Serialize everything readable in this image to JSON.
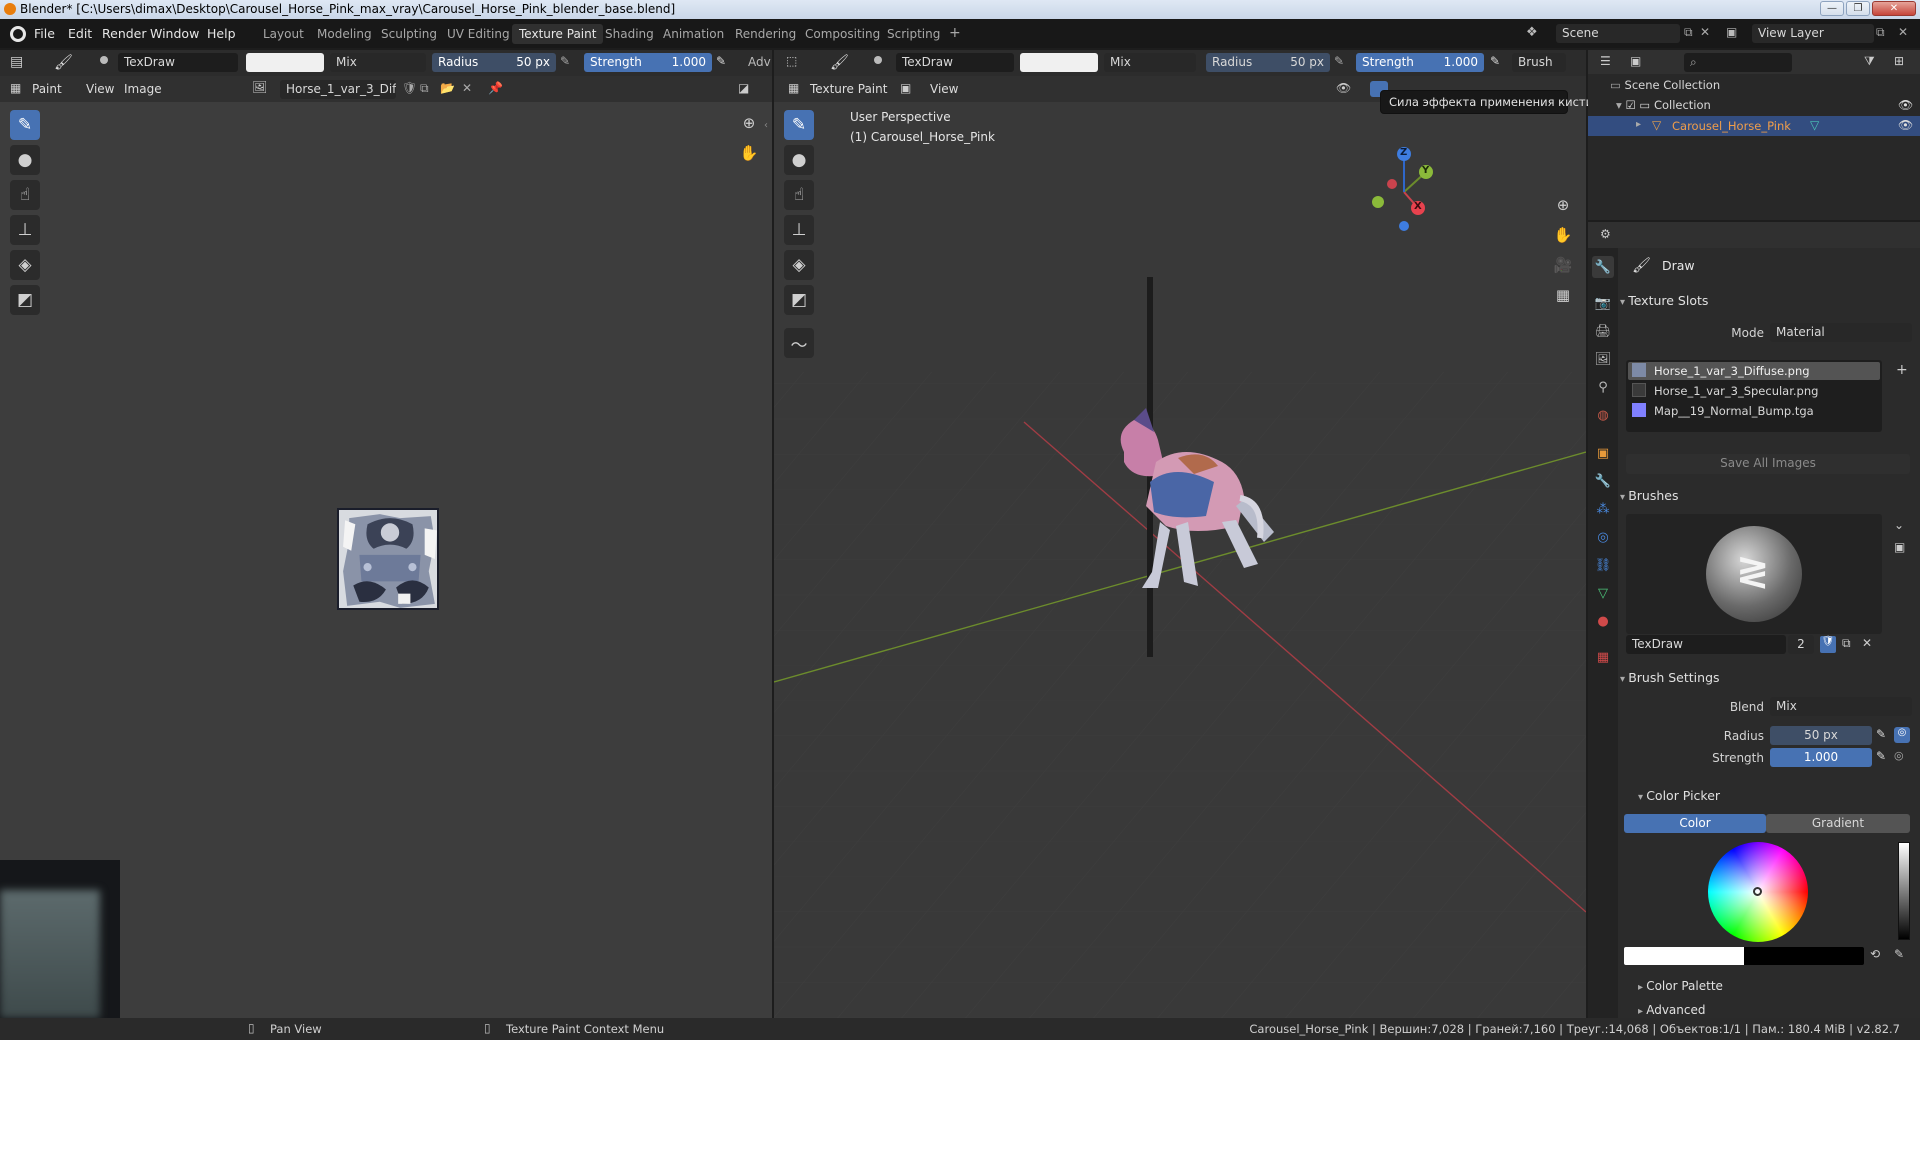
{
  "window": {
    "title": "Blender* [C:\\Users\\dimax\\Desktop\\Carousel_Horse_Pink_max_vray\\Carousel_Horse_Pink_blender_base.blend]",
    "minimize": "—",
    "maximize": "❐",
    "close": "✕"
  },
  "menu": [
    "File",
    "Edit",
    "Render",
    "Window",
    "Help"
  ],
  "workspaces": [
    "Layout",
    "Modeling",
    "Sculpting",
    "UV Editing",
    "Texture Paint",
    "Shading",
    "Animation",
    "Rendering",
    "Compositing",
    "Scripting",
    "+"
  ],
  "scene": {
    "label": "Scene",
    "view_layer": "View Layer"
  },
  "left_editor": {
    "brush_name": "TexDraw",
    "blend": "Mix",
    "radius_label": "Radius",
    "radius_value": "50 px",
    "strength_label": "Strength",
    "strength_value": "1.000",
    "adv": "Adv",
    "mode": "Paint",
    "view": "View",
    "image": "Image",
    "image_name": "Horse_1_var_3_Diff..."
  },
  "viewport": {
    "brush_name": "TexDraw",
    "blend": "Mix",
    "radius_label": "Radius",
    "radius_value": "50 px",
    "strength_label": "Strength",
    "strength_value": "1.000",
    "brush_menu": "Brush",
    "mode": "Texture Paint",
    "view": "View",
    "perspective": "User Perspective",
    "object_label": "(1) Carousel_Horse_Pink",
    "tooltip": "Сила эффекта применения кисти.",
    "gizmo": {
      "x": "X",
      "y": "Y",
      "z": "Z"
    }
  },
  "outliner": {
    "scene_collection": "Scene Collection",
    "collection": "Collection",
    "object": "Carousel_Horse_Pink"
  },
  "properties": {
    "brush_header": "Draw",
    "texture_slots": {
      "title": "Texture Slots",
      "mode_label": "Mode",
      "mode_value": "Material",
      "slots": [
        "Horse_1_var_3_Diffuse.png",
        "Horse_1_var_3_Specular.png",
        "Map__19_Normal_Bump.tga"
      ],
      "save_all": "Save All Images"
    },
    "brushes": {
      "title": "Brushes",
      "name": "TexDraw",
      "users": "2"
    },
    "brush_settings": {
      "title": "Brush Settings",
      "blend_label": "Blend",
      "blend_value": "Mix",
      "radius_label": "Radius",
      "radius_value": "50 px",
      "strength_label": "Strength",
      "strength_value": "1.000"
    },
    "color_picker": {
      "title": "Color Picker",
      "color_tab": "Color",
      "gradient_tab": "Gradient"
    },
    "color_palette": "Color Palette",
    "advanced": "Advanced"
  },
  "statusbar": {
    "pan": "Pan View",
    "context": "Texture Paint Context Menu",
    "stats": "Carousel_Horse_Pink | Вершин:7,028 | Граней:7,160 | Треуг.:14,068 | Объектов:1/1 | Пам.: 180.4 MiB | v2.82.7"
  },
  "colors": {
    "accent": "#4772b3",
    "grid_x": "#a03c44",
    "grid_y": "#6c8c2c",
    "selected_row": "#334d80"
  }
}
